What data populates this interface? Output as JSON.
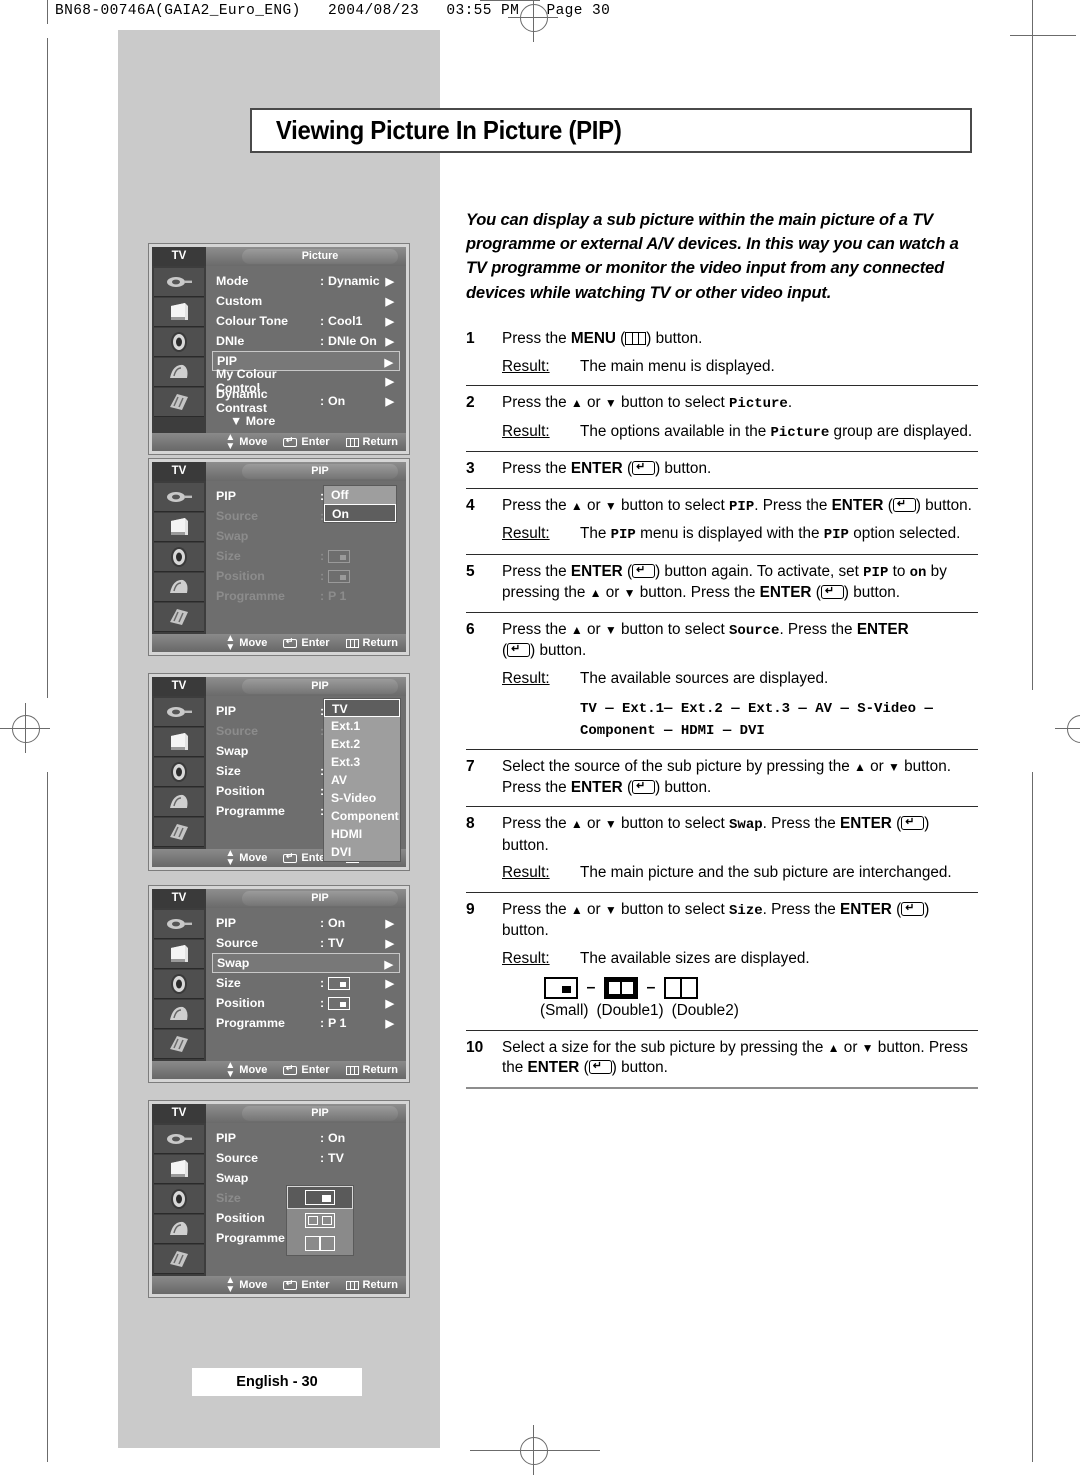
{
  "print_header": "BN68-00746A(GAIA2_Euro_ENG)   2004/08/23   03:55 PM   Page 30",
  "title": "Viewing Picture In Picture (PIP)",
  "intro": "You can display a sub picture within the main picture of a TV programme or external A/V devices. In this way you can watch a TV programme or monitor the video input from any connected devices while watching TV or other video input.",
  "footer": "English - 30",
  "labels": {
    "result": "Result:",
    "press_the": "Press the",
    "button_word": "button."
  },
  "steps": [
    {
      "num": "1",
      "body_a": "Press the ",
      "strong": "MENU",
      "body_b": " (",
      "body_c": ") button.",
      "result_label": "Result:",
      "result": "The main menu is displayed."
    },
    {
      "num": "2",
      "text_1": "Press the ",
      "text_2": " or ",
      "text_3": " button to select ",
      "mono_1": "Picture",
      "text_4": ".",
      "result_label": "Result:",
      "result_1": "The options available in the ",
      "result_mono": "Picture",
      "result_2": " group are displayed."
    },
    {
      "num": "3",
      "text_1": "Press the ",
      "strong": "ENTER",
      "text_2": " (",
      "text_3": ") button."
    },
    {
      "num": "4",
      "text_1": "Press the ",
      "text_2": " or ",
      "text_3": " button to select ",
      "mono_1": "PIP",
      "text_4": ". Press the ",
      "strong": "ENTER",
      "text_5": " (",
      "text_6": ") button.",
      "result_label": "Result:",
      "result_1": "The ",
      "result_mono_1": "PIP",
      "result_2": " menu is displayed with the ",
      "result_mono_2": "PIP",
      "result_3": " option selected."
    },
    {
      "num": "5",
      "text_1": "Press the ",
      "strong_1": "ENTER",
      "text_2": " (",
      "text_3": ") button again. To activate, set ",
      "mono_1": "PIP",
      "text_4": " to ",
      "mono_2": "on",
      "text_5": " by pressing the ",
      "text_6": " or ",
      "text_7": " button. Press the ",
      "strong_2": "ENTER",
      "text_8": " (",
      "text_9": ") button."
    },
    {
      "num": "6",
      "text_1": "Press the ",
      "text_2": " or ",
      "text_3": " button to select ",
      "mono_1": "Source",
      "text_4": ". Press the ",
      "strong": "ENTER",
      "text_5": " (",
      "text_6": ") button.",
      "result_label": "Result:",
      "result": "The available sources are displayed.",
      "source_line_1": "TV — Ext.1— Ext.2 — Ext.3 — AV — S-Video —",
      "source_line_2": "Component — HDMI — DVI"
    },
    {
      "num": "7",
      "text_1": "Select the source of the sub picture by pressing the ",
      "text_2": " or ",
      "text_3": " button. Press the ",
      "strong": "ENTER",
      "text_4": " (",
      "text_5": ") button."
    },
    {
      "num": "8",
      "text_1": "Press the ",
      "text_2": " or ",
      "text_3": " button to select ",
      "mono_1": "Swap",
      "text_4": ". Press the ",
      "strong": "ENTER",
      "text_5": " (",
      "text_6": ") button.",
      "result_label": "Result:",
      "result": "The main picture and the sub picture are interchanged."
    },
    {
      "num": "9",
      "text_1": "Press the ",
      "text_2": " or ",
      "text_3": " button to select ",
      "mono_1": "Size",
      "text_4": ". Press the ",
      "strong": "ENTER",
      "text_5": " (",
      "text_6": ") button.",
      "result_label": "Result:",
      "result": "The available sizes are displayed.",
      "size_labels": [
        "(Small)",
        "(Double1)",
        "(Double2)"
      ],
      "size_separator": "–"
    },
    {
      "num": "10",
      "text_1": "Select a size for the sub picture by pressing the ",
      "text_2": " or ",
      "text_3": " button. Press the ",
      "strong": "ENTER",
      "text_4": " (",
      "text_5": ") button."
    }
  ],
  "osd": {
    "tv_tag": "TV",
    "footer": {
      "move": "Move",
      "enter": "Enter",
      "return": "Return"
    },
    "menu1": {
      "title": "Picture",
      "rows": [
        {
          "label": "Mode",
          "colon": ":",
          "value": "Dynamic",
          "arrow": true
        },
        {
          "label": "Custom",
          "colon": "",
          "value": "",
          "arrow": true
        },
        {
          "label": "Colour Tone",
          "colon": ":",
          "value": "Cool1",
          "arrow": true
        },
        {
          "label": "DNIe",
          "colon": ":",
          "value": "DNIe On",
          "arrow": true
        },
        {
          "label": "PIP",
          "colon": "",
          "value": "",
          "arrow": true,
          "selected": true
        },
        {
          "label": "My Colour Control",
          "colon": "",
          "value": "",
          "arrow": true
        },
        {
          "label": "Dynamic Contrast",
          "colon": ":",
          "value": "On",
          "arrow": true
        },
        {
          "label": "▼ More",
          "colon": "",
          "value": "",
          "arrow": false,
          "more": true
        }
      ]
    },
    "menu2": {
      "title": "PIP",
      "rows": [
        {
          "label": "PIP",
          "colon": ":",
          "value": "",
          "dim": false
        },
        {
          "label": "Source",
          "colon": ":",
          "value": "",
          "dim": true
        },
        {
          "label": "Swap",
          "colon": "",
          "value": "",
          "dim": true
        },
        {
          "label": "Size",
          "colon": ":",
          "value": "box-small",
          "dim": true
        },
        {
          "label": "Position",
          "colon": ":",
          "value": "box-small",
          "dim": true
        },
        {
          "label": "Programme",
          "colon": ":",
          "value": "P  1",
          "dim": true
        }
      ],
      "dropdown": [
        "Off",
        "On"
      ],
      "dropdown_current": "On"
    },
    "menu3": {
      "title": "PIP",
      "rows": [
        {
          "label": "PIP",
          "colon": ":",
          "dim": false
        },
        {
          "label": "Source",
          "colon": ":",
          "dim": true
        },
        {
          "label": "Swap",
          "colon": "",
          "dim": false
        },
        {
          "label": "Size",
          "colon": ":",
          "dim": false
        },
        {
          "label": "Position",
          "colon": ":",
          "dim": false
        },
        {
          "label": "Programme",
          "colon": ":",
          "dim": false
        }
      ],
      "sources": [
        "TV",
        "Ext.1",
        "Ext.2",
        "Ext.3",
        "AV",
        "S-Video",
        "Component",
        "HDMI",
        "DVI"
      ],
      "sources_current": "TV"
    },
    "menu4": {
      "title": "PIP",
      "rows": [
        {
          "label": "PIP",
          "colon": ":",
          "value": "On",
          "arrow": true
        },
        {
          "label": "Source",
          "colon": ":",
          "value": "TV",
          "arrow": true
        },
        {
          "label": "Swap",
          "colon": "",
          "value": "",
          "arrow": true,
          "selected": true
        },
        {
          "label": "Size",
          "colon": ":",
          "value": "box-small",
          "arrow": true
        },
        {
          "label": "Position",
          "colon": ":",
          "value": "box-dot",
          "arrow": true
        },
        {
          "label": "Programme",
          "colon": ":",
          "value": "P  1",
          "arrow": true
        }
      ]
    },
    "menu5": {
      "title": "PIP",
      "rows": [
        {
          "label": "PIP",
          "colon": ":",
          "value": "On",
          "dim": false
        },
        {
          "label": "Source",
          "colon": ":",
          "value": "TV",
          "dim": false
        },
        {
          "label": "Swap",
          "colon": "",
          "value": "",
          "dim": false
        },
        {
          "label": "Size",
          "colon": ":",
          "value": "",
          "dim": true
        },
        {
          "label": "Position",
          "colon": ":",
          "value": "",
          "dim": false
        },
        {
          "label": "Programme",
          "colon": ":",
          "value": "",
          "dim": false
        }
      ],
      "size_options": [
        "small",
        "double1",
        "double2"
      ],
      "size_current": "small"
    }
  },
  "colors": {
    "page_gray": "#cacaca",
    "osd_body": "#6e6e6e",
    "osd_dim_text": "#8c8c8c",
    "rule": "#8d8d8d"
  }
}
